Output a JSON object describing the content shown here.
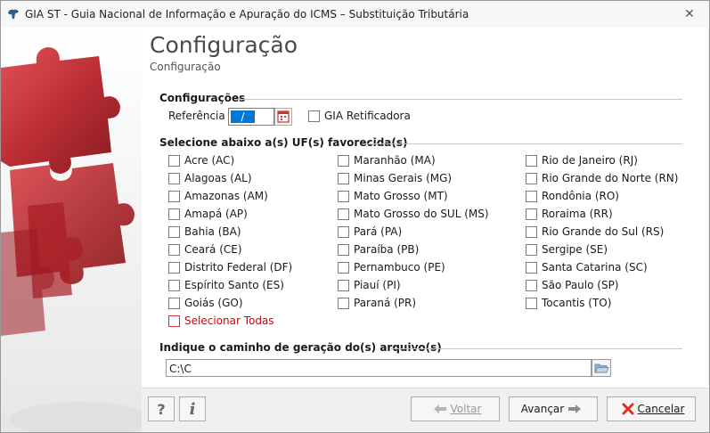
{
  "window": {
    "title": "GIA ST - Guia Nacional de Informação e Apuração do ICMS – Substituição Tributária",
    "close_glyph": "✕"
  },
  "page": {
    "title": "Configuração",
    "subtitle": "Configuração"
  },
  "config_section": {
    "header": "Configurações",
    "referencia_label": "Referência",
    "referencia_value": "/",
    "retificadora_label": "GIA Retificadora",
    "retificadora_checked": false
  },
  "uf_section": {
    "header": "Selecione abaixo a(s) UF(s) favorecida(s)",
    "columns": [
      [
        "Acre (AC)",
        "Alagoas (AL)",
        "Amazonas (AM)",
        "Amapá (AP)",
        "Bahia (BA)",
        "Ceará (CE)",
        "Distrito Federal (DF)",
        "Espírito Santo (ES)",
        "Goiás (GO)"
      ],
      [
        "Maranhão (MA)",
        "Minas Gerais (MG)",
        "Mato Grosso (MT)",
        "Mato Grosso do SUL (MS)",
        "Pará (PA)",
        "Paraíba (PB)",
        "Pernambuco (PE)",
        "Piauí (PI)",
        "Paraná (PR)"
      ],
      [
        "Rio de Janeiro (RJ)",
        "Rio Grande do Norte (RN)",
        "Rondônia (RO)",
        "Roraima (RR)",
        "Rio Grande do Sul (RS)",
        "Sergipe (SE)",
        "Santa Catarina (SC)",
        "São Paulo (SP)",
        "Tocantis (TO)"
      ]
    ],
    "select_all_label": "Selecionar Todas"
  },
  "path_section": {
    "header": "Indique o caminho de geração do(s) arquivo(s)",
    "path_value": "C:\\C"
  },
  "buttons": {
    "help_label": "?",
    "info_label": "i",
    "voltar_label": "Voltar",
    "avancar_label": "Avançar",
    "cancelar_label": "Cancelar"
  },
  "colors": {
    "accent_selection": "#0078d7",
    "select_all_red": "#d40000",
    "cancel_red": "#e0301e",
    "arrow_gray": "#8c8c8c",
    "puzzle_red": "#c0272d"
  }
}
